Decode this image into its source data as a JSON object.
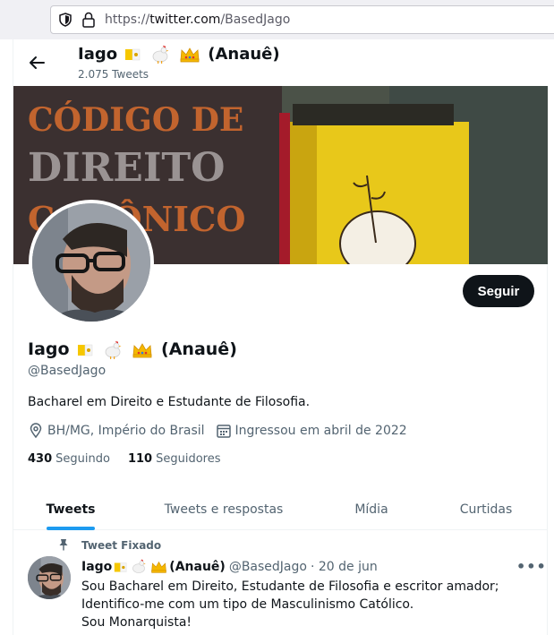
{
  "browser": {
    "url_scheme": "https://",
    "url_host": "twitter.com",
    "url_path": "/BasedJago"
  },
  "header": {
    "name": "Iago",
    "suffix": "(Anauê)",
    "tweet_count": "2.075 Tweets"
  },
  "banner": {
    "book_line1": "CÓDIGO DE",
    "book_line2": "DIREITO",
    "book_line3": "CANÔNICO"
  },
  "profile": {
    "name": "Iago",
    "suffix": "(Anauê)",
    "handle": "@BasedJago",
    "bio": "Bacharel em Direito e Estudante de Filosofia.",
    "location": "BH/MG, Império do Brasil",
    "joined": "Ingressou em abril de 2022",
    "following_count": "430",
    "following_label": "Seguindo",
    "followers_count": "110",
    "followers_label": "Seguidores",
    "follow_button": "Seguir"
  },
  "tabs": [
    {
      "label": "Tweets",
      "active": true
    },
    {
      "label": "Tweets e respostas",
      "active": false
    },
    {
      "label": "Mídia",
      "active": false
    },
    {
      "label": "Curtidas",
      "active": false
    }
  ],
  "pinned_tweet": {
    "pin_label": "Tweet Fixado",
    "name": "Iago",
    "suffix": "(Anauê)",
    "handle": "@BasedJago",
    "date": "· 20 de jun",
    "lines": [
      "Sou Bacharel em Direito, Estudante de Filosofia e escritor amador;",
      "Identifico-me com um tipo de Masculinismo Católico.",
      "Sou Monarquista!"
    ]
  },
  "icons": [
    "shield-icon",
    "lock-icon",
    "back-arrow-icon",
    "location-icon",
    "calendar-icon",
    "pin-icon",
    "more-icon",
    "vatican-flag-icon",
    "rooster-icon",
    "crown-icon"
  ],
  "colors": {
    "accent": "#1d9bf0",
    "text": "#0f1419",
    "muted": "#536471",
    "button": "#0f1419"
  }
}
